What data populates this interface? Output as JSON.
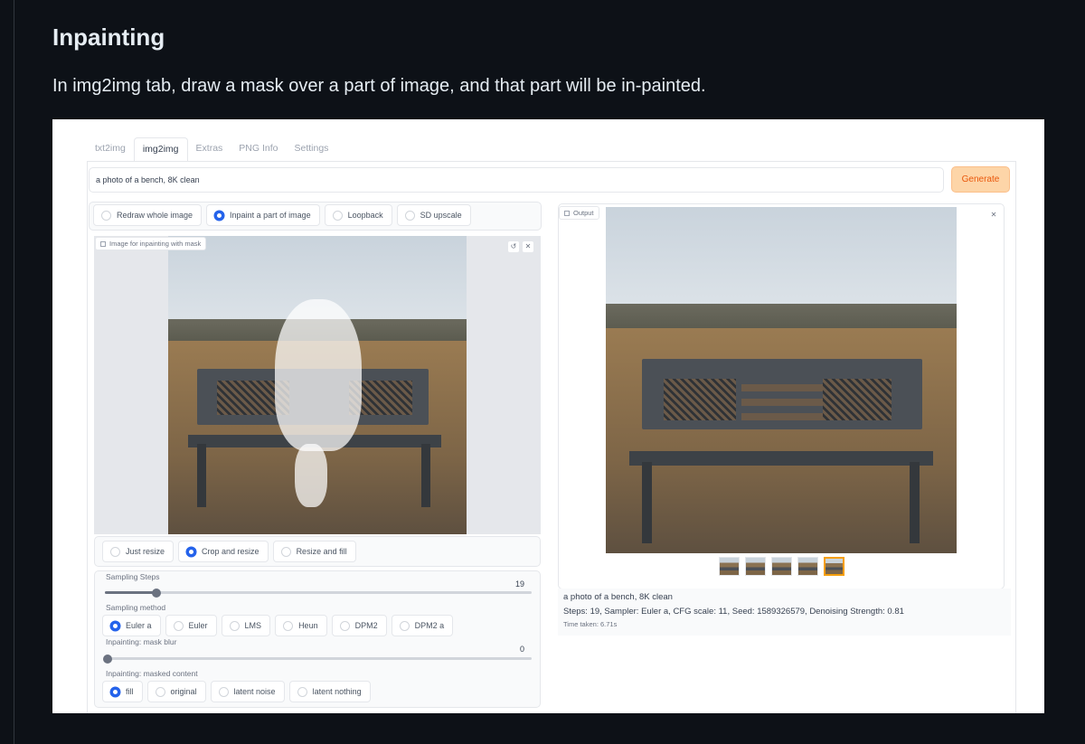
{
  "article": {
    "heading": "Inpainting",
    "description": "In img2img tab, draw a mask over a part of image, and that part will be in-painted."
  },
  "tabs": [
    {
      "label": "txt2img",
      "active": false
    },
    {
      "label": "img2img",
      "active": true
    },
    {
      "label": "Extras",
      "active": false
    },
    {
      "label": "PNG Info",
      "active": false
    },
    {
      "label": "Settings",
      "active": false
    }
  ],
  "prompt": {
    "value": "a photo of a bench, 8K clean"
  },
  "generate_label": "Generate",
  "mode_options": [
    {
      "label": "Redraw whole image",
      "selected": false
    },
    {
      "label": "Inpaint a part of image",
      "selected": true
    },
    {
      "label": "Loopback",
      "selected": false
    },
    {
      "label": "SD upscale",
      "selected": false
    }
  ],
  "input_image": {
    "label": "Image for inpainting with mask"
  },
  "resize_options": [
    {
      "label": "Just resize",
      "selected": false
    },
    {
      "label": "Crop and resize",
      "selected": true
    },
    {
      "label": "Resize and fill",
      "selected": false
    }
  ],
  "sampling_steps": {
    "label": "Sampling Steps",
    "value": "19",
    "min": 1,
    "max": 150,
    "current": 19
  },
  "sampling_method": {
    "label": "Sampling method",
    "options": [
      {
        "label": "Euler a",
        "selected": true
      },
      {
        "label": "Euler",
        "selected": false
      },
      {
        "label": "LMS",
        "selected": false
      },
      {
        "label": "Heun",
        "selected": false
      },
      {
        "label": "DPM2",
        "selected": false
      },
      {
        "label": "DPM2 a",
        "selected": false
      }
    ]
  },
  "mask_blur": {
    "label": "Inpainting: mask blur",
    "value": "0",
    "current": 0
  },
  "masked_content": {
    "label": "Inpainting: masked content",
    "options": [
      {
        "label": "fill",
        "selected": true
      },
      {
        "label": "original",
        "selected": false
      },
      {
        "label": "latent noise",
        "selected": false
      },
      {
        "label": "latent nothing",
        "selected": false
      }
    ]
  },
  "output": {
    "label": "Output",
    "selected_thumbnail": 4,
    "thumbnail_count": 5,
    "info_prompt": "a photo of a bench, 8K clean",
    "info_params": "Steps: 19, Sampler: Euler a, CFG scale: 11, Seed: 1589326579, Denoising Strength: 0.81",
    "time_taken": "Time taken: 6.71s"
  },
  "colors": {
    "accent": "#2563eb",
    "generate_bg": "#fdd5a8",
    "generate_text": "#ea580c",
    "page_bg": "#0d1117"
  }
}
